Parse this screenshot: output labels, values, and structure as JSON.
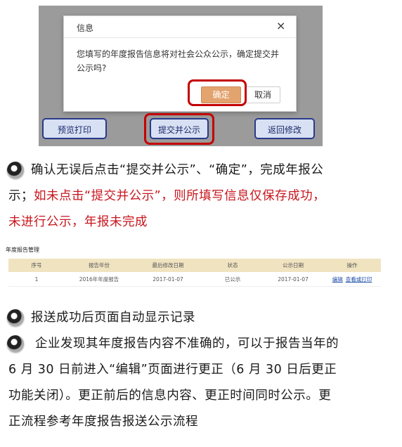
{
  "dialog": {
    "title": "信息",
    "close_glyph": "×",
    "message": "您填写的年度报告信息将对社会公众公示，确定提交并公示吗?",
    "ok_label": "确定",
    "cancel_label": "取消"
  },
  "toolbar": {
    "print_label": "预览打印",
    "submit_label": "提交并公示",
    "back_label": "返回修改"
  },
  "step1": {
    "line1": "确认无误后点击“提交并公示”、“确定”，完成年报公",
    "line2_black": "示；",
    "line2_red": "如未点击“提交并公示”，则所填写信息仅保存成功，",
    "line3_red": "未进行公示，年报未完成"
  },
  "table": {
    "title": "年度报告管理",
    "headers": [
      "序号",
      "报告年份",
      "最后修改日期",
      "状态",
      "公示日期",
      "操作"
    ],
    "rows": [
      {
        "no": "1",
        "year": "2016年年度报告",
        "modified": "2017-01-07",
        "status": "已公示",
        "published": "2017-01-07",
        "action_edit": "编辑",
        "action_view": "查看或打印"
      }
    ]
  },
  "step2": {
    "line1": "报送成功后页面自动显示记录"
  },
  "step3": {
    "line1": "企业发现其年度报告内容不准确的，可以于报告当年的",
    "line2": "6 月 30 日前进入“编辑”页面进行更正（6 月 30 日后更正",
    "line3": "功能关闭）。更正前后的信息内容、更正时间同时公示。更",
    "line4": "正流程参考年度报告报送公示流程"
  }
}
